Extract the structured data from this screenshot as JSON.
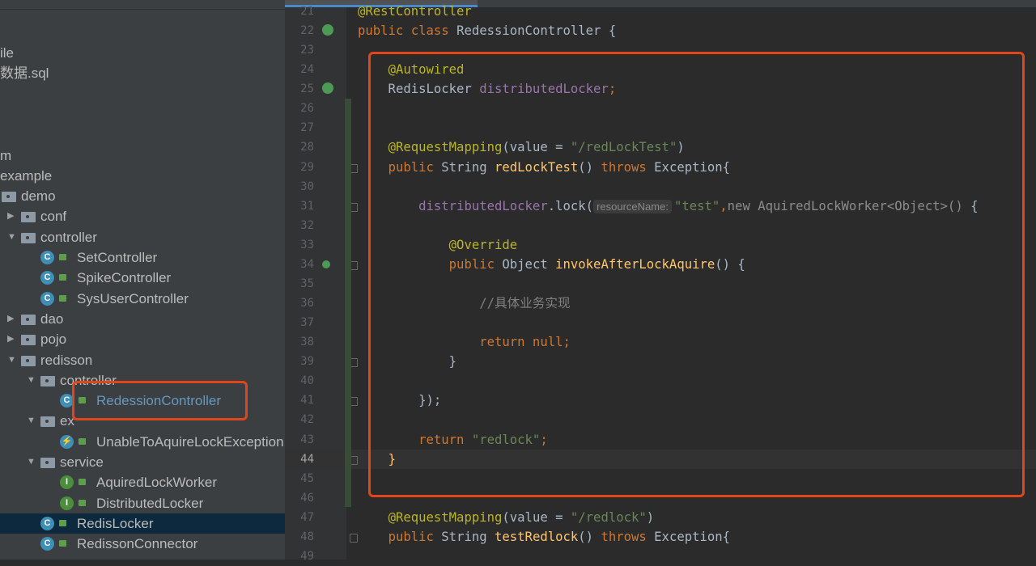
{
  "sidebar": {
    "items": [
      {
        "label": "ile",
        "row": 0,
        "level": -1
      },
      {
        "label": "数据.sql",
        "row": 1,
        "level": -1
      },
      {
        "label": "m",
        "row": 5,
        "level": -1
      },
      {
        "label": "example",
        "row": 6,
        "level": -1
      },
      {
        "label": "demo",
        "row": 7,
        "level": 0,
        "type": "folder",
        "expanded": true
      },
      {
        "label": "conf",
        "row": 8,
        "level": 1,
        "type": "folder",
        "expanded": false
      },
      {
        "label": "controller",
        "row": 9,
        "level": 1,
        "type": "folder",
        "expanded": true
      },
      {
        "label": "SetController",
        "row": 10,
        "level": 2,
        "type": "class"
      },
      {
        "label": "SpikeController",
        "row": 11,
        "level": 2,
        "type": "class"
      },
      {
        "label": "SysUserController",
        "row": 12,
        "level": 2,
        "type": "class"
      },
      {
        "label": "dao",
        "row": 13,
        "level": 1,
        "type": "folder",
        "expanded": false
      },
      {
        "label": "pojo",
        "row": 14,
        "level": 1,
        "type": "folder",
        "expanded": false
      },
      {
        "label": "redisson",
        "row": 15,
        "level": 1,
        "type": "folder",
        "expanded": true
      },
      {
        "label": "controller",
        "row": 16,
        "level": 2,
        "type": "folder",
        "expanded": true
      },
      {
        "label": "RedessionController",
        "row": 17,
        "level": 3,
        "type": "class",
        "highlight": true
      },
      {
        "label": "ex",
        "row": 18,
        "level": 2,
        "type": "folder",
        "expanded": true
      },
      {
        "label": "UnableToAquireLockException",
        "row": 19,
        "level": 3,
        "type": "exception"
      },
      {
        "label": "service",
        "row": 20,
        "level": 2,
        "type": "folder",
        "expanded": true
      },
      {
        "label": "AquiredLockWorker",
        "row": 21,
        "level": 3,
        "type": "interface"
      },
      {
        "label": "DistributedLocker",
        "row": 22,
        "level": 3,
        "type": "interface"
      },
      {
        "label": "RedisLocker",
        "row": 23,
        "level": 2,
        "type": "class",
        "selected": true
      },
      {
        "label": "RedissonConnector",
        "row": 24,
        "level": 2,
        "type": "class"
      }
    ]
  },
  "colors": {
    "class": "#3d8fb5",
    "interface": "#4c8f3a",
    "exception": "#3d8fb5",
    "annotation_box": "#e0461a",
    "selection": "#0d293e"
  },
  "editor": {
    "current_line": 44,
    "lines": [
      {
        "n": "21",
        "t": [
          [
            "@RestController",
            "ann"
          ]
        ]
      },
      {
        "n": "22",
        "icon": "spring-bean-icon",
        "t": [
          [
            "public class ",
            "kw"
          ],
          [
            "RedessionController {",
            ""
          ]
        ]
      },
      {
        "n": "23",
        "t": []
      },
      {
        "n": "24",
        "t": [
          [
            "    ",
            ""
          ],
          [
            "@Autowired",
            "ann"
          ]
        ]
      },
      {
        "n": "25",
        "icon": "autowired-icon",
        "t": [
          [
            "    RedisLocker ",
            ""
          ],
          [
            "distributedLocker",
            "fld"
          ],
          [
            ";",
            "kw"
          ]
        ]
      },
      {
        "n": "26",
        "t": []
      },
      {
        "n": "27",
        "t": []
      },
      {
        "n": "28",
        "t": [
          [
            "    ",
            ""
          ],
          [
            "@RequestMapping",
            "ann"
          ],
          [
            "(value = ",
            ""
          ],
          [
            "\"/redLockTest\"",
            "str"
          ],
          [
            ")",
            ""
          ]
        ]
      },
      {
        "n": "29",
        "fold": true,
        "t": [
          [
            "    ",
            ""
          ],
          [
            "public ",
            "kw"
          ],
          [
            "String ",
            ""
          ],
          [
            "redLockTest",
            "fn"
          ],
          [
            "() ",
            ""
          ],
          [
            "throws ",
            "kw"
          ],
          [
            "Exception{",
            ""
          ]
        ]
      },
      {
        "n": "30",
        "t": []
      },
      {
        "n": "31",
        "fold": true,
        "t": [
          [
            "        ",
            ""
          ],
          [
            "distributedLocker",
            "fld"
          ],
          [
            ".lock(",
            ""
          ],
          [
            "resourceName:",
            "hint"
          ],
          [
            "\"test\"",
            "str"
          ],
          [
            ",",
            "kw"
          ],
          [
            "new AquiredLockWorker<Object>() ",
            "grey"
          ],
          [
            "{",
            ""
          ]
        ]
      },
      {
        "n": "32",
        "t": []
      },
      {
        "n": "33",
        "t": [
          [
            "            ",
            ""
          ],
          [
            "@Override",
            "ann"
          ]
        ]
      },
      {
        "n": "34",
        "icon": "override-icon",
        "fold": true,
        "t": [
          [
            "            ",
            ""
          ],
          [
            "public ",
            "kw"
          ],
          [
            "Object ",
            ""
          ],
          [
            "invokeAfterLockAquire",
            "fn"
          ],
          [
            "() {",
            ""
          ]
        ]
      },
      {
        "n": "35",
        "t": []
      },
      {
        "n": "36",
        "t": [
          [
            "                ",
            ""
          ],
          [
            "//具体业务实现",
            "cmt"
          ]
        ]
      },
      {
        "n": "37",
        "t": []
      },
      {
        "n": "38",
        "t": [
          [
            "                ",
            ""
          ],
          [
            "return null",
            "kw"
          ],
          [
            ";",
            "kw"
          ]
        ]
      },
      {
        "n": "39",
        "fold": true,
        "t": [
          [
            "            }",
            ""
          ]
        ]
      },
      {
        "n": "40",
        "t": []
      },
      {
        "n": "41",
        "fold": true,
        "t": [
          [
            "        });",
            ""
          ]
        ]
      },
      {
        "n": "42",
        "t": []
      },
      {
        "n": "43",
        "t": [
          [
            "        ",
            ""
          ],
          [
            "return ",
            "kw"
          ],
          [
            "\"redlock\"",
            "str"
          ],
          [
            ";",
            "kw"
          ]
        ]
      },
      {
        "n": "44",
        "fold": true,
        "t": [
          [
            "    ",
            ""
          ],
          [
            "}",
            "fn"
          ]
        ]
      },
      {
        "n": "45",
        "t": []
      },
      {
        "n": "46",
        "t": []
      },
      {
        "n": "47",
        "t": [
          [
            "    ",
            ""
          ],
          [
            "@RequestMapping",
            "ann"
          ],
          [
            "(value = ",
            ""
          ],
          [
            "\"/redlock\"",
            "str"
          ],
          [
            ")",
            ""
          ]
        ]
      },
      {
        "n": "48",
        "fold": true,
        "t": [
          [
            "    ",
            ""
          ],
          [
            "public ",
            "kw"
          ],
          [
            "String ",
            ""
          ],
          [
            "testRedlock",
            "fn"
          ],
          [
            "() ",
            ""
          ],
          [
            "throws ",
            "kw"
          ],
          [
            "Exception{",
            ""
          ]
        ]
      },
      {
        "n": "49",
        "t": []
      }
    ]
  }
}
